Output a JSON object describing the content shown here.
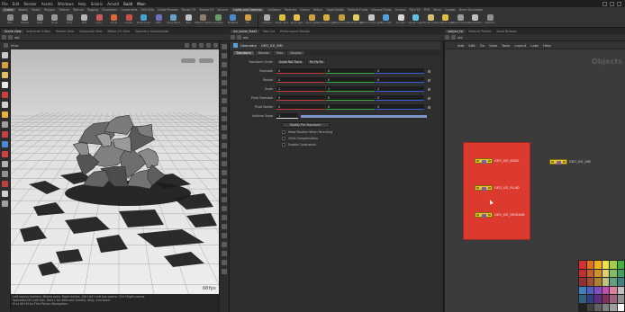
{
  "menubar": {
    "items": [
      "File",
      "Edit",
      "Render",
      "Assets",
      "Windows",
      "Help",
      "Solaris",
      "Arnold"
    ],
    "build": "Build",
    "title": "Main"
  },
  "shelf": {
    "tabs_left": [
      "Create",
      "Modify",
      "Model",
      "Polygon",
      "Deform",
      "Texture",
      "Rigging",
      "Characters",
      "Constraints",
      "Hair Utils",
      "Guide Process",
      "Terrain FX",
      "Simple FX",
      "Volume"
    ],
    "tabs_right": [
      "Lights and Cameras",
      "Collisions",
      "Particles",
      "Grains",
      "Vellum",
      "Rigid Bodies",
      "Particle Fluids",
      "Viscous Fluids",
      "Oceans",
      "Pyro FX",
      "FEM",
      "Wires",
      "Crowds",
      "Drive Simulation"
    ],
    "tools_left": [
      "Box",
      "Sphere",
      "Tube",
      "Torus",
      "Grid",
      "Null",
      "Line",
      "Circle",
      "Curve",
      "Draw Curve",
      "Path",
      "Spray Paint",
      "Text",
      "Platonic Solids",
      "L-System",
      "Metaball",
      "File"
    ],
    "tools_right": [
      "Camera",
      "Point Light",
      "Spot Light",
      "Area Light",
      "Geometry Light",
      "Volume Light",
      "Distant Light",
      "Environment Light",
      "Sky Light",
      "GI Light",
      "Caustic Light",
      "Portal Light",
      "Ambient Light",
      "Stereo Camera",
      "VR Camera",
      "Switcher"
    ],
    "colors": {
      "left": [
        "#8a8a8a",
        "#9a9a9a",
        "#8f8f8f",
        "#999999",
        "#7f7f7f",
        "#b5b5b5",
        "#cc5a5a",
        "#d86a3a",
        "#c8504a",
        "#4aa0d0",
        "#7070c0",
        "#6aa0c8",
        "#c0c0c0",
        "#8f7f6f",
        "#6a9a6a",
        "#4a8ac8",
        "#d0a040"
      ],
      "right": [
        "#b0b0b0",
        "#e0c040",
        "#e8c050",
        "#d0a040",
        "#d8b040",
        "#c0a040",
        "#e0d060",
        "#c8c8c8",
        "#50a0e0",
        "#d8d8d8",
        "#60c0e0",
        "#d0c070",
        "#e0c040",
        "#9a9a9a",
        "#c0c0c0",
        "#8f8f8f"
      ]
    }
  },
  "panel_tabs_left": [
    "Scene View",
    "Animation Editor",
    "Render View",
    "Composite View",
    "Motion FX View",
    "Geometry Spreadsheet"
  ],
  "panel_tabs_mid": [
    "ice_solver_fluid1",
    "Take List",
    "Performance Monitor"
  ],
  "panel_tabs_right": [
    "/obj/ice_fx/",
    "Material Palette",
    "Asset Browser"
  ],
  "path_left": "obj",
  "path_mid": "obj",
  "path_right": "obj",
  "viewport": {
    "toolbar_label": "View",
    "fps": "60fps",
    "tools_left_colors": [
      "#c8c8c8",
      "#d8a040",
      "#e0c060",
      "#e8e8e8",
      "#c84040",
      "#d0d0d0",
      "#e8b040",
      "#a0a0a0",
      "#c84040",
      "#4a8ad0",
      "#d04040",
      "#b0b0b0",
      "#909090",
      "#c04040",
      "#d0d0d0",
      "#a0a0a0"
    ]
  },
  "status": {
    "line1": "Left mouse tumbles. Middle pans. Right dollies. Ctrl+Alt+Left box-zooms. Ctrl+Right zooms.",
    "line2": "Spacebar-Ctrl-Left tilts. Hold L for alternate tumble, dolly, and zoom.",
    "line3": "M or Alt+M for First Person Navigation."
  },
  "params": {
    "node_type": "Geometry",
    "node_name": "GEO_ICE_SIM",
    "tabs": [
      "Transform",
      "Render",
      "Misc",
      "Display"
    ],
    "rows": [
      {
        "label": "Transform Order",
        "drop1": "Scale Rot Trans",
        "drop2": "Rx Ry Rz"
      },
      {
        "label": "Translate",
        "x": "0",
        "y": "0",
        "z": "0"
      },
      {
        "label": "Rotate",
        "x": "0",
        "y": "0",
        "z": "0"
      },
      {
        "label": "Scale",
        "x": "1",
        "y": "1",
        "z": "1"
      },
      {
        "label": "Pivot Translate",
        "x": "0",
        "y": "0",
        "z": "0"
      },
      {
        "label": "Pivot Rotate",
        "x": "0",
        "y": "0",
        "z": "0"
      }
    ],
    "uniform_scale_label": "Uniform Scale",
    "uniform_scale_value": "1",
    "uniform_scale_fraction": 1.0,
    "button": "Modify Pre-Transform",
    "checks": [
      "Keep Position When Parenting",
      "Child Compensation",
      "Enable Constraints"
    ]
  },
  "network": {
    "menu": [
      "Add",
      "Edit",
      "Go",
      "View",
      "Tools",
      "Layout",
      "Labs",
      "Help"
    ],
    "title": "Objects",
    "nodes": [
      "GEO_ICE_BODY",
      "GEO_ICE_FLUID",
      "GEO_ICE_GROUND"
    ],
    "outside_node": "GEO_ICE_SIM",
    "palette": [
      "#d83030",
      "#e07020",
      "#f0b020",
      "#f0e040",
      "#a0d040",
      "#40b040",
      "#c03030",
      "#c06030",
      "#d09030",
      "#e0d070",
      "#80c060",
      "#40a060",
      "#903030",
      "#a05030",
      "#b08030",
      "#c0c080",
      "#60a080",
      "#408080",
      "#4080c0",
      "#5060c0",
      "#8050c0",
      "#c050b0",
      "#e080a0",
      "#c0c0c0",
      "#306080",
      "#304080",
      "#603080",
      "#803060",
      "#a06080",
      "#909090",
      "#202020",
      "#404040",
      "#606060",
      "#808080",
      "#a0a0a0",
      "#ffffff"
    ]
  }
}
